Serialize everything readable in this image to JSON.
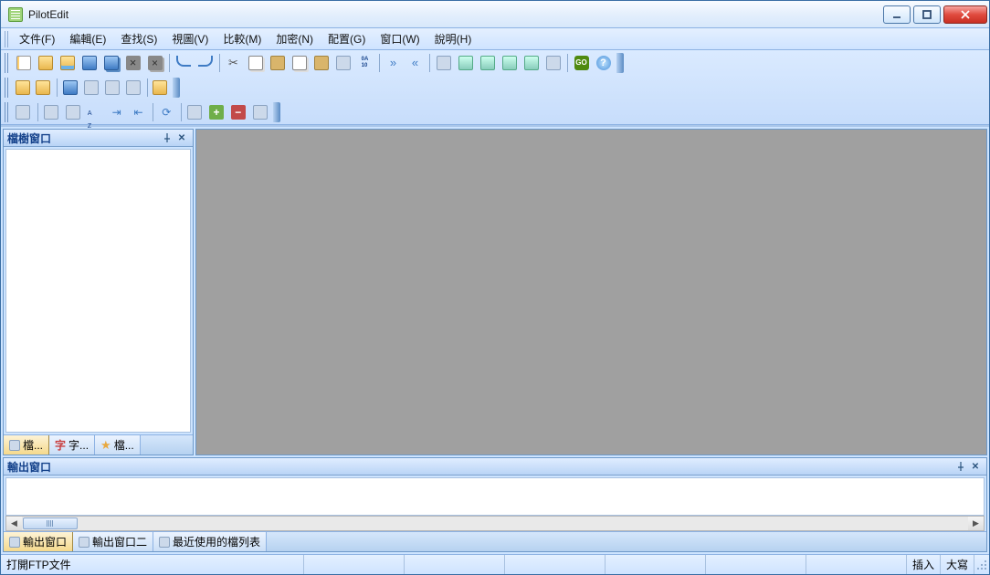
{
  "title": "PilotEdit",
  "menu": {
    "file": "文件(F)",
    "edit": "編輯(E)",
    "search": "查找(S)",
    "view": "視圖(V)",
    "compare": "比較(M)",
    "encrypt": "加密(N)",
    "config": "配置(G)",
    "window": "窗口(W)",
    "help": "說明(H)"
  },
  "panels": {
    "file_tree": "檔樹窗口",
    "output": "輸出窗口"
  },
  "side_tabs": {
    "t1": "檔...",
    "t2": "字...",
    "t3": "檔..."
  },
  "output_tabs": {
    "t1": "輸出窗口",
    "t2": "輸出窗口二",
    "t3": "最近使用的檔列表"
  },
  "status": {
    "left": "打開FTP文件",
    "insert": "插入",
    "caps": "大寫"
  }
}
